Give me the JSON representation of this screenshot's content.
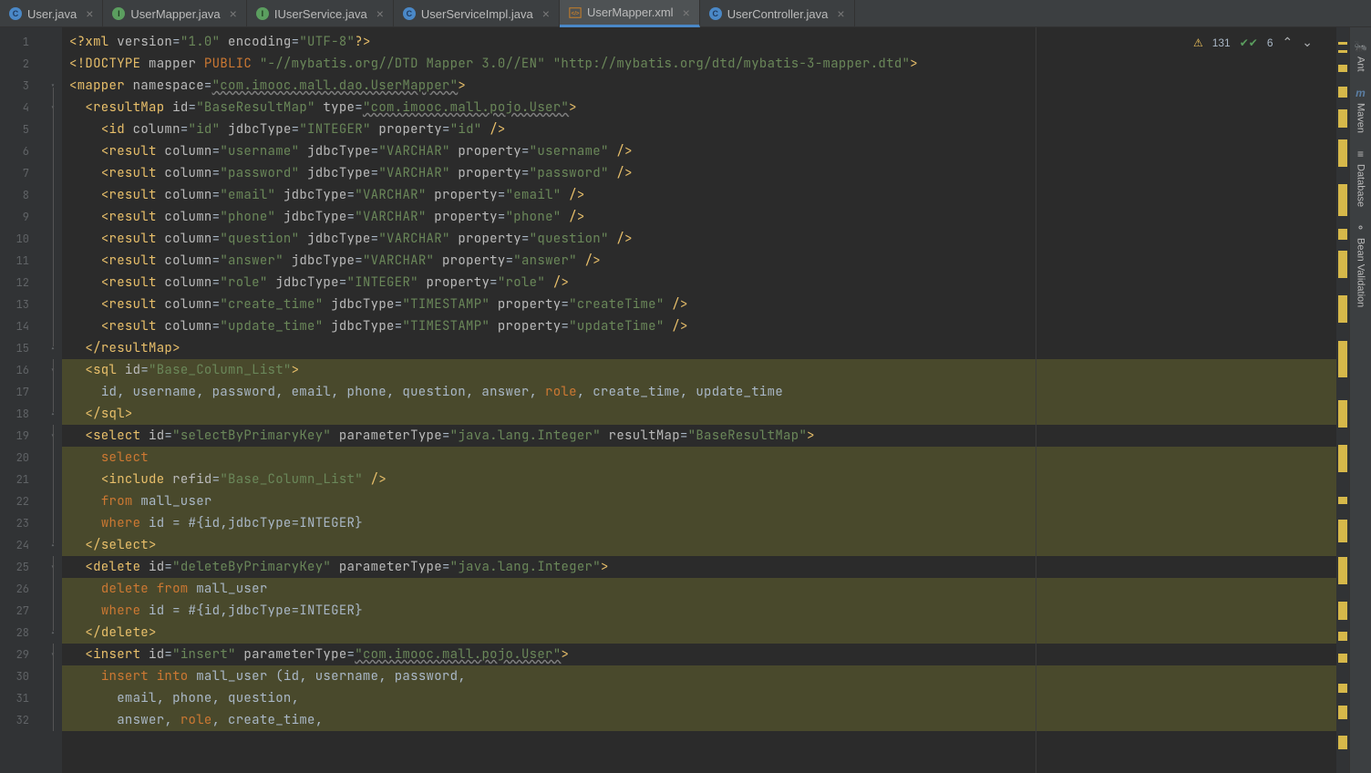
{
  "tabs": [
    {
      "icon": "C",
      "iconClass": "c",
      "label": "User.java",
      "active": false
    },
    {
      "icon": "I",
      "iconClass": "i",
      "label": "UserMapper.java",
      "active": false
    },
    {
      "icon": "I",
      "iconClass": "i",
      "label": "IUserService.java",
      "active": false
    },
    {
      "icon": "C",
      "iconClass": "c",
      "label": "UserServiceImpl.java",
      "active": false
    },
    {
      "icon": "",
      "iconClass": "xml",
      "label": "UserMapper.xml",
      "active": true
    },
    {
      "icon": "C",
      "iconClass": "c",
      "label": "UserController.java",
      "active": false
    }
  ],
  "status": {
    "warnings": "131",
    "checks": "6"
  },
  "lines": [
    "1",
    "2",
    "3",
    "4",
    "5",
    "6",
    "7",
    "8",
    "9",
    "10",
    "11",
    "12",
    "13",
    "14",
    "15",
    "16",
    "17",
    "18",
    "19",
    "20",
    "21",
    "22",
    "23",
    "24",
    "25",
    "26",
    "27",
    "28",
    "29",
    "30",
    "31",
    "32"
  ],
  "code": {
    "l1": {
      "pre": "<?",
      "tag": "xml ",
      "a1": "version",
      "v1": "\"1.0\"",
      "a2": " encoding",
      "v2": "\"UTF-8\"",
      "post": "?>"
    },
    "l2": {
      "pre": "<!",
      "tag": "DOCTYPE ",
      "a1": "mapper ",
      "kw": "PUBLIC ",
      "v1": "\"-//mybatis.org//DTD Mapper 3.0//EN\" \"http://mybatis.org/dtd/mybatis-3-mapper.dtd\"",
      "post": ">"
    },
    "l3": {
      "tag": "mapper",
      "a1": " namespace",
      "v1": "\"com.imooc.mall.dao.UserMapper\""
    },
    "l4": {
      "tag": "resultMap",
      "a1": " id",
      "v1": "\"BaseResultMap\"",
      "a2": " type",
      "v2": "\"com.imooc.mall.pojo.User\""
    },
    "l5": {
      "tag": "id",
      "a1": " column",
      "v1": "\"id\"",
      "a2": " jdbcType",
      "v2": "\"INTEGER\"",
      "a3": " property",
      "v3": "\"id\""
    },
    "l6": {
      "tag": "result",
      "a1": " column",
      "v1": "\"username\"",
      "a2": " jdbcType",
      "v2": "\"VARCHAR\"",
      "a3": " property",
      "v3": "\"username\""
    },
    "l7": {
      "tag": "result",
      "a1": " column",
      "v1": "\"password\"",
      "a2": " jdbcType",
      "v2": "\"VARCHAR\"",
      "a3": " property",
      "v3": "\"password\""
    },
    "l8": {
      "tag": "result",
      "a1": " column",
      "v1": "\"email\"",
      "a2": " jdbcType",
      "v2": "\"VARCHAR\"",
      "a3": " property",
      "v3": "\"email\""
    },
    "l9": {
      "tag": "result",
      "a1": " column",
      "v1": "\"phone\"",
      "a2": " jdbcType",
      "v2": "\"VARCHAR\"",
      "a3": " property",
      "v3": "\"phone\""
    },
    "l10": {
      "tag": "result",
      "a1": " column",
      "v1": "\"question\"",
      "a2": " jdbcType",
      "v2": "\"VARCHAR\"",
      "a3": " property",
      "v3": "\"question\""
    },
    "l11": {
      "tag": "result",
      "a1": " column",
      "v1": "\"answer\"",
      "a2": " jdbcType",
      "v2": "\"VARCHAR\"",
      "a3": " property",
      "v3": "\"answer\""
    },
    "l12": {
      "tag": "result",
      "a1": " column",
      "v1": "\"role\"",
      "a2": " jdbcType",
      "v2": "\"INTEGER\"",
      "a3": " property",
      "v3": "\"role\""
    },
    "l13": {
      "tag": "result",
      "a1": " column",
      "v1": "\"create_time\"",
      "a2": " jdbcType",
      "v2": "\"TIMESTAMP\"",
      "a3": " property",
      "v3": "\"createTime\""
    },
    "l14": {
      "tag": "result",
      "a1": " column",
      "v1": "\"update_time\"",
      "a2": " jdbcType",
      "v2": "\"TIMESTAMP\"",
      "a3": " property",
      "v3": "\"updateTime\""
    },
    "l15": {
      "close": "resultMap"
    },
    "l16": {
      "tag": "sql",
      "a1": " id",
      "v1": "\"Base_Column_List\""
    },
    "l17": {
      "txt": "id, username, password, email, phone, question, answer, ",
      "kw": "role",
      "txt2": ", create_time, update_time"
    },
    "l18": {
      "close": "sql"
    },
    "l19": {
      "tag": "select",
      "a1": " id",
      "v1": "\"selectByPrimaryKey\"",
      "a2": " parameterType",
      "v2": "\"java.lang.Integer\"",
      "a3": " resultMap",
      "v3": "\"BaseResultMap\""
    },
    "l20": {
      "kw": "select"
    },
    "l21": {
      "tag": "include",
      "a1": " refid",
      "v1": "\"Base_Column_List\""
    },
    "l22": {
      "kw": "from ",
      "txt": "mall_user"
    },
    "l23": {
      "kw": "where ",
      "txt": "id = #{id,jdbcType=INTEGER}"
    },
    "l24": {
      "close": "select"
    },
    "l25": {
      "tag": "delete",
      "a1": " id",
      "v1": "\"deleteByPrimaryKey\"",
      "a2": " parameterType",
      "v2": "\"java.lang.Integer\""
    },
    "l26": {
      "kw": "delete from ",
      "txt": "mall_user"
    },
    "l27": {
      "kw": "where ",
      "txt": "id = #{id,jdbcType=INTEGER}"
    },
    "l28": {
      "close": "delete"
    },
    "l29": {
      "tag": "insert",
      "a1": " id",
      "v1": "\"insert\"",
      "a2": " parameterType",
      "v2": "\"com.imooc.mall.pojo.User\""
    },
    "l30": {
      "kw": "insert into ",
      "txt": "mall_user (id, username, password,"
    },
    "l31": {
      "txt": "email, phone, question,"
    },
    "l32": {
      "txt": "answer, ",
      "kw": "role",
      "txt2": ", create_time,"
    }
  },
  "sideTools": [
    {
      "icon": "🐜",
      "label": "Ant"
    },
    {
      "icon": "m",
      "label": "Maven"
    },
    {
      "icon": "🗄",
      "label": "Database"
    },
    {
      "icon": "✓",
      "label": "Bean Validation"
    }
  ]
}
